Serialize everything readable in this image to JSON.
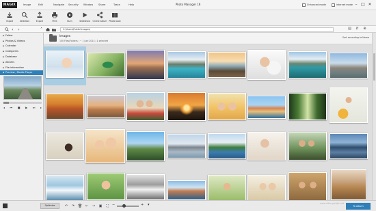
{
  "app": {
    "logo": "MAGIX",
    "title": "Photo Manager 16",
    "menu": [
      "Image",
      "Edit",
      "Navigate",
      "Security",
      "Window",
      "Share",
      "Tasks",
      "Help"
    ],
    "title_right": [
      "Enhanced mode",
      "Internet mode"
    ],
    "window_buttons": [
      "–",
      "□",
      "✕"
    ]
  },
  "toolbar": {
    "tools": [
      {
        "label": "Import",
        "icon": "import-icon"
      },
      {
        "label": "Selection",
        "icon": "selection-icon"
      },
      {
        "label": "Export",
        "icon": "export-icon"
      },
      {
        "label": "Print",
        "icon": "print-icon"
      },
      {
        "label": "Burn",
        "icon": "burn-disc-icon"
      },
      {
        "label": "Slideshow",
        "icon": "slideshow-play-icon"
      },
      {
        "label": "Online Album",
        "icon": "share-icon"
      },
      {
        "label": "Photo book",
        "icon": "photo-book-icon"
      }
    ]
  },
  "addressbar": {
    "path": "C:\\Users\\Public\\Images\\"
  },
  "sidebar": {
    "items": [
      {
        "label": "Folder"
      },
      {
        "label": "Photos & Videos"
      },
      {
        "label": "Calendar"
      },
      {
        "label": "Categories"
      },
      {
        "label": "Database"
      },
      {
        "label": "Albums"
      },
      {
        "label": "File information"
      },
      {
        "label": "Preview / Media Player",
        "active": true
      }
    ]
  },
  "main": {
    "folder_name": "Images",
    "folder_info": "100 Files/Folders | ~ 1 Juni 2014 | 1 selected",
    "sort_label": "Sort according to Name"
  },
  "bottombar": {
    "optimize_label": "Optimize",
    "to_album_label": "To album",
    "watermark": "www.xitongzhijia.net"
  },
  "colors": {
    "accent": "#2f80b8",
    "selection": "#a9cde3",
    "logo_bg": "#1c1c1c"
  }
}
